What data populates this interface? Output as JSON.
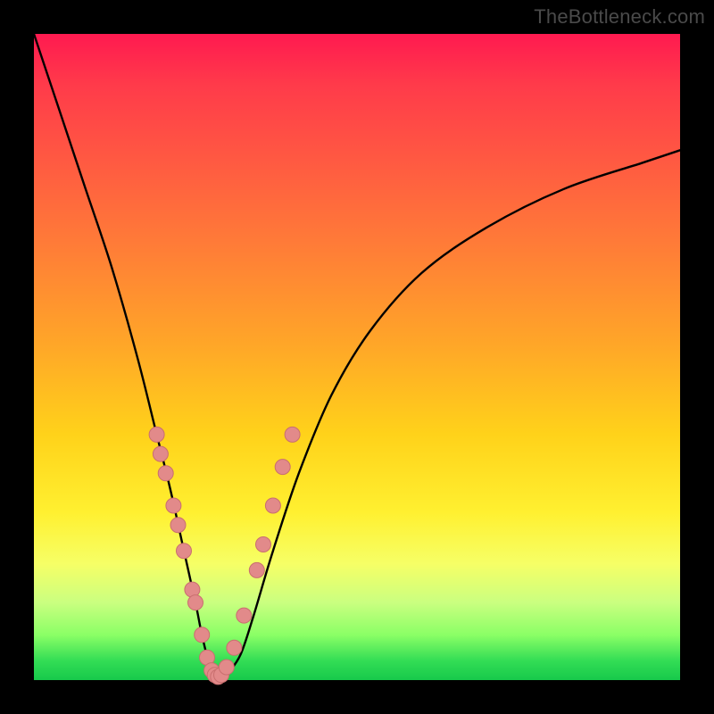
{
  "watermark": {
    "text": "TheBottleneck.com"
  },
  "chart_data": {
    "type": "line",
    "title": "",
    "xlabel": "",
    "ylabel": "",
    "xlim": [
      0,
      100
    ],
    "ylim": [
      0,
      100
    ],
    "grid": false,
    "legend": false,
    "series": [
      {
        "name": "bottleneck-curve",
        "x": [
          0,
          4,
          8,
          12,
          16,
          19,
          21,
          23,
          25,
          26,
          27,
          28,
          29,
          30,
          32,
          34,
          37,
          41,
          46,
          52,
          60,
          70,
          82,
          94,
          100
        ],
        "y": [
          100,
          88,
          76,
          64,
          50,
          38,
          30,
          21,
          12,
          7,
          3,
          1,
          0,
          1,
          4,
          10,
          20,
          32,
          44,
          54,
          63,
          70,
          76,
          80,
          82
        ]
      }
    ],
    "markers": [
      {
        "name": "dots",
        "points": [
          {
            "x": 19.0,
            "y": 38
          },
          {
            "x": 19.6,
            "y": 35
          },
          {
            "x": 20.4,
            "y": 32
          },
          {
            "x": 21.6,
            "y": 27
          },
          {
            "x": 22.3,
            "y": 24
          },
          {
            "x": 23.2,
            "y": 20
          },
          {
            "x": 24.5,
            "y": 14
          },
          {
            "x": 25.0,
            "y": 12
          },
          {
            "x": 26.0,
            "y": 7
          },
          {
            "x": 26.8,
            "y": 3.5
          },
          {
            "x": 27.5,
            "y": 1.5
          },
          {
            "x": 28.0,
            "y": 0.8
          },
          {
            "x": 28.5,
            "y": 0.5
          },
          {
            "x": 29.0,
            "y": 0.8
          },
          {
            "x": 29.8,
            "y": 2
          },
          {
            "x": 31.0,
            "y": 5
          },
          {
            "x": 32.5,
            "y": 10
          },
          {
            "x": 34.5,
            "y": 17
          },
          {
            "x": 35.5,
            "y": 21
          },
          {
            "x": 37.0,
            "y": 27
          },
          {
            "x": 38.5,
            "y": 33
          },
          {
            "x": 40.0,
            "y": 38
          }
        ]
      }
    ],
    "colors": {
      "curve": "#000000",
      "marker_fill": "#e28a8a",
      "marker_stroke": "#c96f6f"
    }
  }
}
